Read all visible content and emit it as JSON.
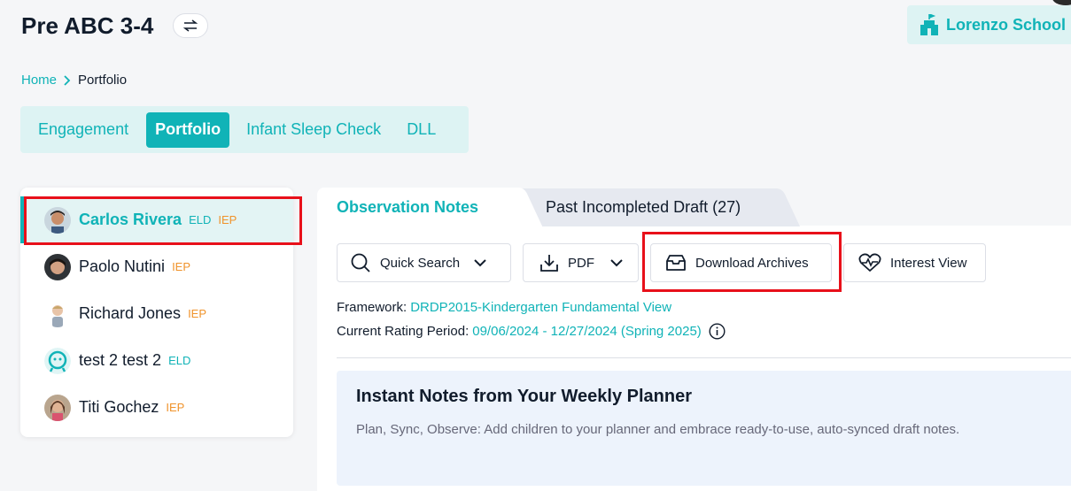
{
  "header": {
    "title": "Pre ABC 3-4",
    "school_name": "Lorenzo School D"
  },
  "breadcrumb": {
    "home": "Home",
    "separator": ">",
    "current": "Portfolio"
  },
  "main_tabs": [
    {
      "label": "Engagement",
      "active": false
    },
    {
      "label": "Portfolio",
      "active": true
    },
    {
      "label": "Infant Sleep Check",
      "active": false
    },
    {
      "label": "DLL",
      "active": false
    }
  ],
  "children": [
    {
      "name": "Carlos Rivera",
      "badges": [
        "ELD",
        "IEP"
      ],
      "active": true
    },
    {
      "name": "Paolo Nutini",
      "badges": [
        "IEP"
      ],
      "active": false
    },
    {
      "name": "Richard Jones",
      "badges": [
        "IEP"
      ],
      "active": false
    },
    {
      "name": "test 2 test 2",
      "badges": [
        "ELD"
      ],
      "active": false
    },
    {
      "name": "Titi Gochez",
      "badges": [
        "IEP"
      ],
      "active": false
    }
  ],
  "content_tabs": {
    "observation": "Observation Notes",
    "draft": "Past Incompleted Draft (27)"
  },
  "toolbar": {
    "quick_search": "Quick Search",
    "pdf": "PDF",
    "download_archives": "Download Archives",
    "interest_view": "Interest View"
  },
  "meta": {
    "framework_label": "Framework:",
    "framework_value": "DRDP2015-Kindergarten Fundamental View",
    "period_label": "Current Rating Period:",
    "period_value": "09/06/2024 - 12/27/2024 (Spring 2025)"
  },
  "planner": {
    "title": "Instant Notes from Your Weekly Planner",
    "description": "Plan, Sync, Observe: Add children to your planner and embrace ready-to-use, auto-synced draft notes."
  },
  "colors": {
    "accent": "#10b3b7",
    "accent_light": "#ddf3f3",
    "iep": "#f0932b",
    "highlight": "#e8101a"
  }
}
